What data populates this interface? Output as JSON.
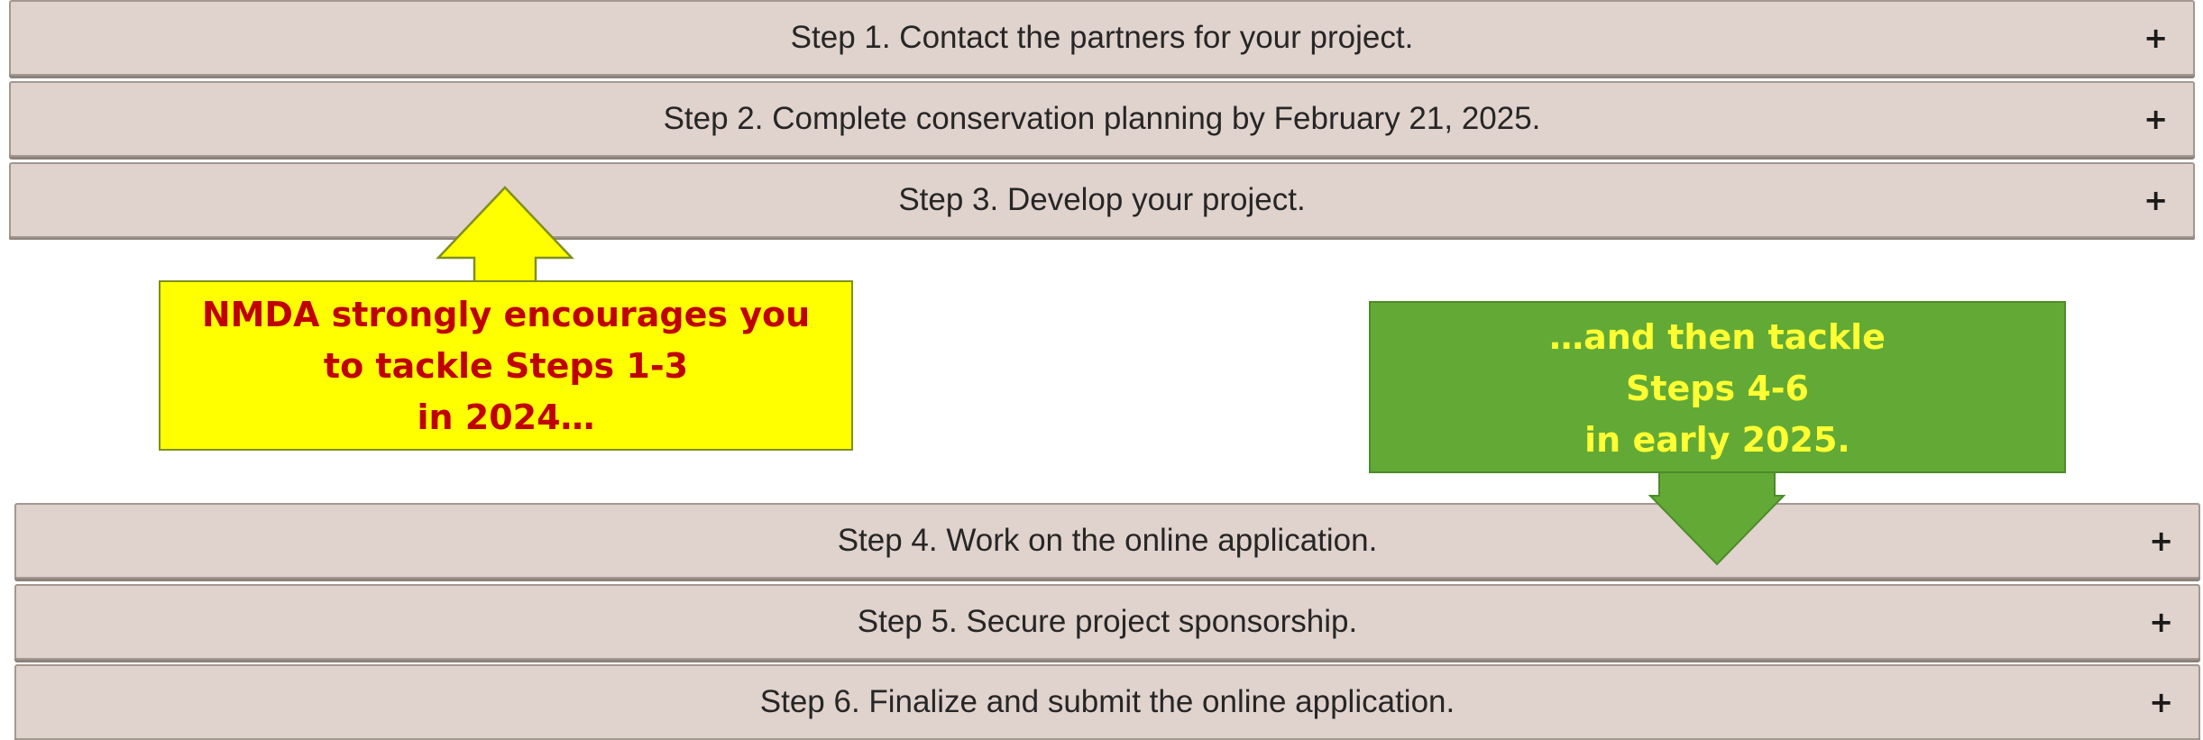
{
  "steps_top": [
    {
      "label": "Step 1. Contact the partners for your project.",
      "expand_icon": "+"
    },
    {
      "label": "Step 2. Complete conservation planning by February 21, 2025.",
      "expand_icon": "+"
    },
    {
      "label": "Step 3. Develop your project.",
      "expand_icon": "+"
    }
  ],
  "steps_bottom": [
    {
      "label": "Step 4. Work on the online application.",
      "expand_icon": "+"
    },
    {
      "label": "Step 5. Secure project sponsorship.",
      "expand_icon": "+"
    },
    {
      "label": "Step 6. Finalize and submit the online application.",
      "expand_icon": "+"
    }
  ],
  "callouts": {
    "yellow": {
      "lines": [
        "NMDA strongly encourages you",
        "to tackle Steps 1-3",
        "in 2024…"
      ],
      "fill_color": "#ffff00",
      "text_color": "#c00000"
    },
    "green": {
      "lines": [
        "…and then tackle",
        "Steps 4-6",
        "in early 2025."
      ],
      "fill_color": "#62aa35",
      "text_color": "#ffff33"
    }
  },
  "colors": {
    "accordion_bg": "#e0d2cc",
    "accordion_border": "#a39890",
    "accordion_text": "#262626"
  }
}
